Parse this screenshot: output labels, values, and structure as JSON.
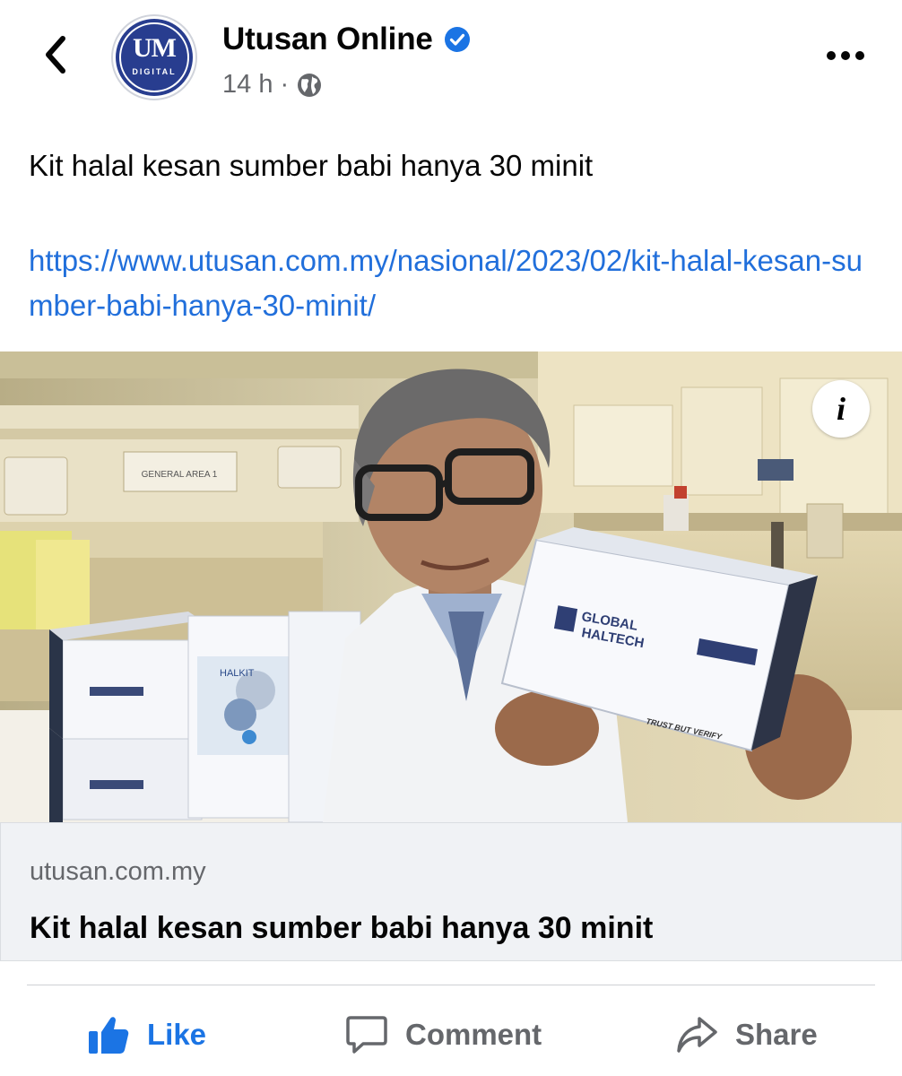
{
  "header": {
    "page_name": "Utusan Online",
    "avatar_logo_main": "UM",
    "avatar_logo_sub": "DIGITAL",
    "time": "14 h",
    "separator": "·",
    "back_icon": "chevron-left-icon",
    "more_icon": "more-horizontal-icon",
    "verified_icon": "verified-badge-icon",
    "audience_icon": "globe-icon"
  },
  "post": {
    "text": "Kit halal kesan sumber babi hanya 30 minit",
    "link": "https://www.utusan.com.my/nasional/2023/02/kit-halal-kesan-sumber-babi-hanya-30-minit/"
  },
  "photo": {
    "info_label": "i",
    "board_label": "GENERAL AREA 1",
    "box_brand_line1": "GLOBAL",
    "box_brand_line2": "HALTECH",
    "box_tagline": "TRUST BUT VERIFY",
    "small_box_label": "HALKIT"
  },
  "link_card": {
    "domain": "utusan.com.my",
    "title": "Kit halal kesan sumber babi hanya 30 minit"
  },
  "actions": {
    "like": "Like",
    "comment": "Comment",
    "share": "Share"
  },
  "colors": {
    "accent_blue": "#1b74e4",
    "link_blue": "#216fdb",
    "secondary_text": "#65676b",
    "logo_navy": "#283d8f"
  }
}
